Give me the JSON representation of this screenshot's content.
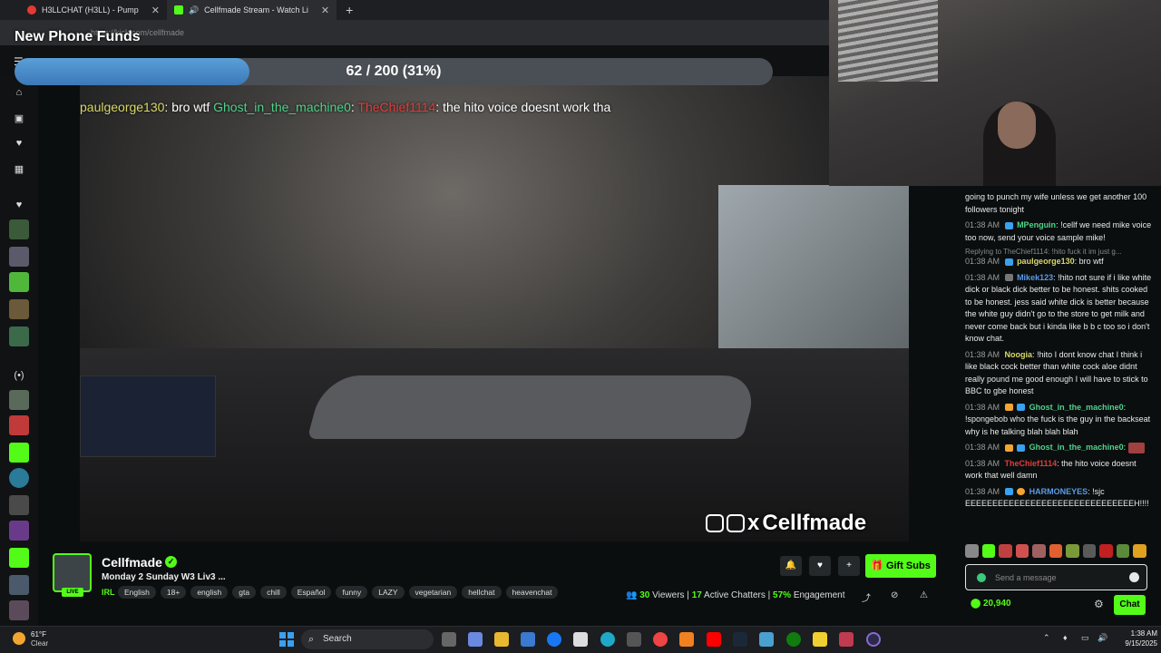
{
  "browser": {
    "tabs": [
      {
        "title": "H3LLCHAT (H3LL) - Pump",
        "color": "#e53935"
      },
      {
        "title": "Cellfmade Stream - Watch Li",
        "color": "#53fc18"
      }
    ],
    "url": "https://kick.com/cellfmade"
  },
  "goal": {
    "title": "New Phone Funds",
    "progress_text": "62 / 200 (31%)",
    "progress_fraction": 0.31
  },
  "video": {
    "overlay_chat": [
      {
        "user": "paulgeorge130",
        "text": "bro wtf"
      },
      {
        "user": "Ghost_in_the_machine0",
        "text": ""
      },
      {
        "user": "TheChief1114",
        "text": "the hito voice doesnt work tha"
      }
    ],
    "watermark": "Cellfmade"
  },
  "chat": {
    "messages": [
      {
        "time": "",
        "user": "",
        "text": "going to punch my wife unless we get another 100 followers tonight"
      },
      {
        "time": "01:38 AM",
        "user": "MPenguin",
        "text": "!cellf we need mike voice too now, send your voice sample mike!",
        "color": "#4ed38a"
      },
      {
        "reply": "Replying to TheChief1114: !hito fuck it im just g..."
      },
      {
        "time": "01:38 AM",
        "user": "paulgeorge130",
        "text": "bro wtf",
        "color": "#d8d86a"
      },
      {
        "time": "01:38 AM",
        "user": "Mikek123",
        "text": "!hito not sure if i like white dick or black dick better to be honest. shits cooked to be honest. jess said white dick is better because the white guy didn't go to the store to get milk and never come back but i kinda like b b c too so i don't know chat.",
        "color": "#5a9be6"
      },
      {
        "time": "01:38 AM",
        "user": "Noogia",
        "text": "!hito I dont know chat I think i like black cock better than white cock aloe didnt really pound me good enough I will have to stick to BBC to gbe honest",
        "color": "#d8d86a"
      },
      {
        "time": "01:38 AM",
        "user": "Ghost_in_the_machine0",
        "text": "!spongebob who the fuck is the guy in the backseat why is he talking blah blah blah",
        "color": "#4ed38a"
      },
      {
        "time": "01:38 AM",
        "user": "Ghost_in_the_machine0",
        "text": "",
        "color": "#4ed38a"
      },
      {
        "time": "01:38 AM",
        "user": "TheChief1114",
        "text": "the hito voice doesnt work that well damn",
        "color": "#e33c3c"
      },
      {
        "time": "01:38 AM",
        "user": "HARMONEYES",
        "text": "!sjc EEEEEEEEEEEEEEEEEEEEEEEEEEEEEEEH!!!!",
        "color": "#5a9be6"
      }
    ],
    "input_placeholder": "Send a message",
    "points": "20,940",
    "send_label": "Chat"
  },
  "channel": {
    "name": "Cellfmade",
    "live_label": "LIVE",
    "title": "Monday 2 Sunday W3 Liv3 ...",
    "category": "IRL",
    "tags": [
      "English",
      "18+",
      "english",
      "gta",
      "chill",
      "Español",
      "funny",
      "LAZY",
      "vegetarian",
      "hellchat",
      "heavenchat"
    ],
    "gift_label": "Gift Subs",
    "viewers": "30",
    "viewers_label": "Viewers",
    "chatters": "17",
    "chatters_label": "Active Chatters",
    "engagement": "57%",
    "engagement_label": "Engagement"
  },
  "taskbar": {
    "weather_temp": "61°F",
    "weather_desc": "Clear",
    "search_label": "Search",
    "time": "1:38 AM",
    "date": "9/15/2025"
  },
  "colors": {
    "kick_green": "#53fc18",
    "progress_blue": "#4a8cc8",
    "chat_bg": "#0b0e0f"
  }
}
